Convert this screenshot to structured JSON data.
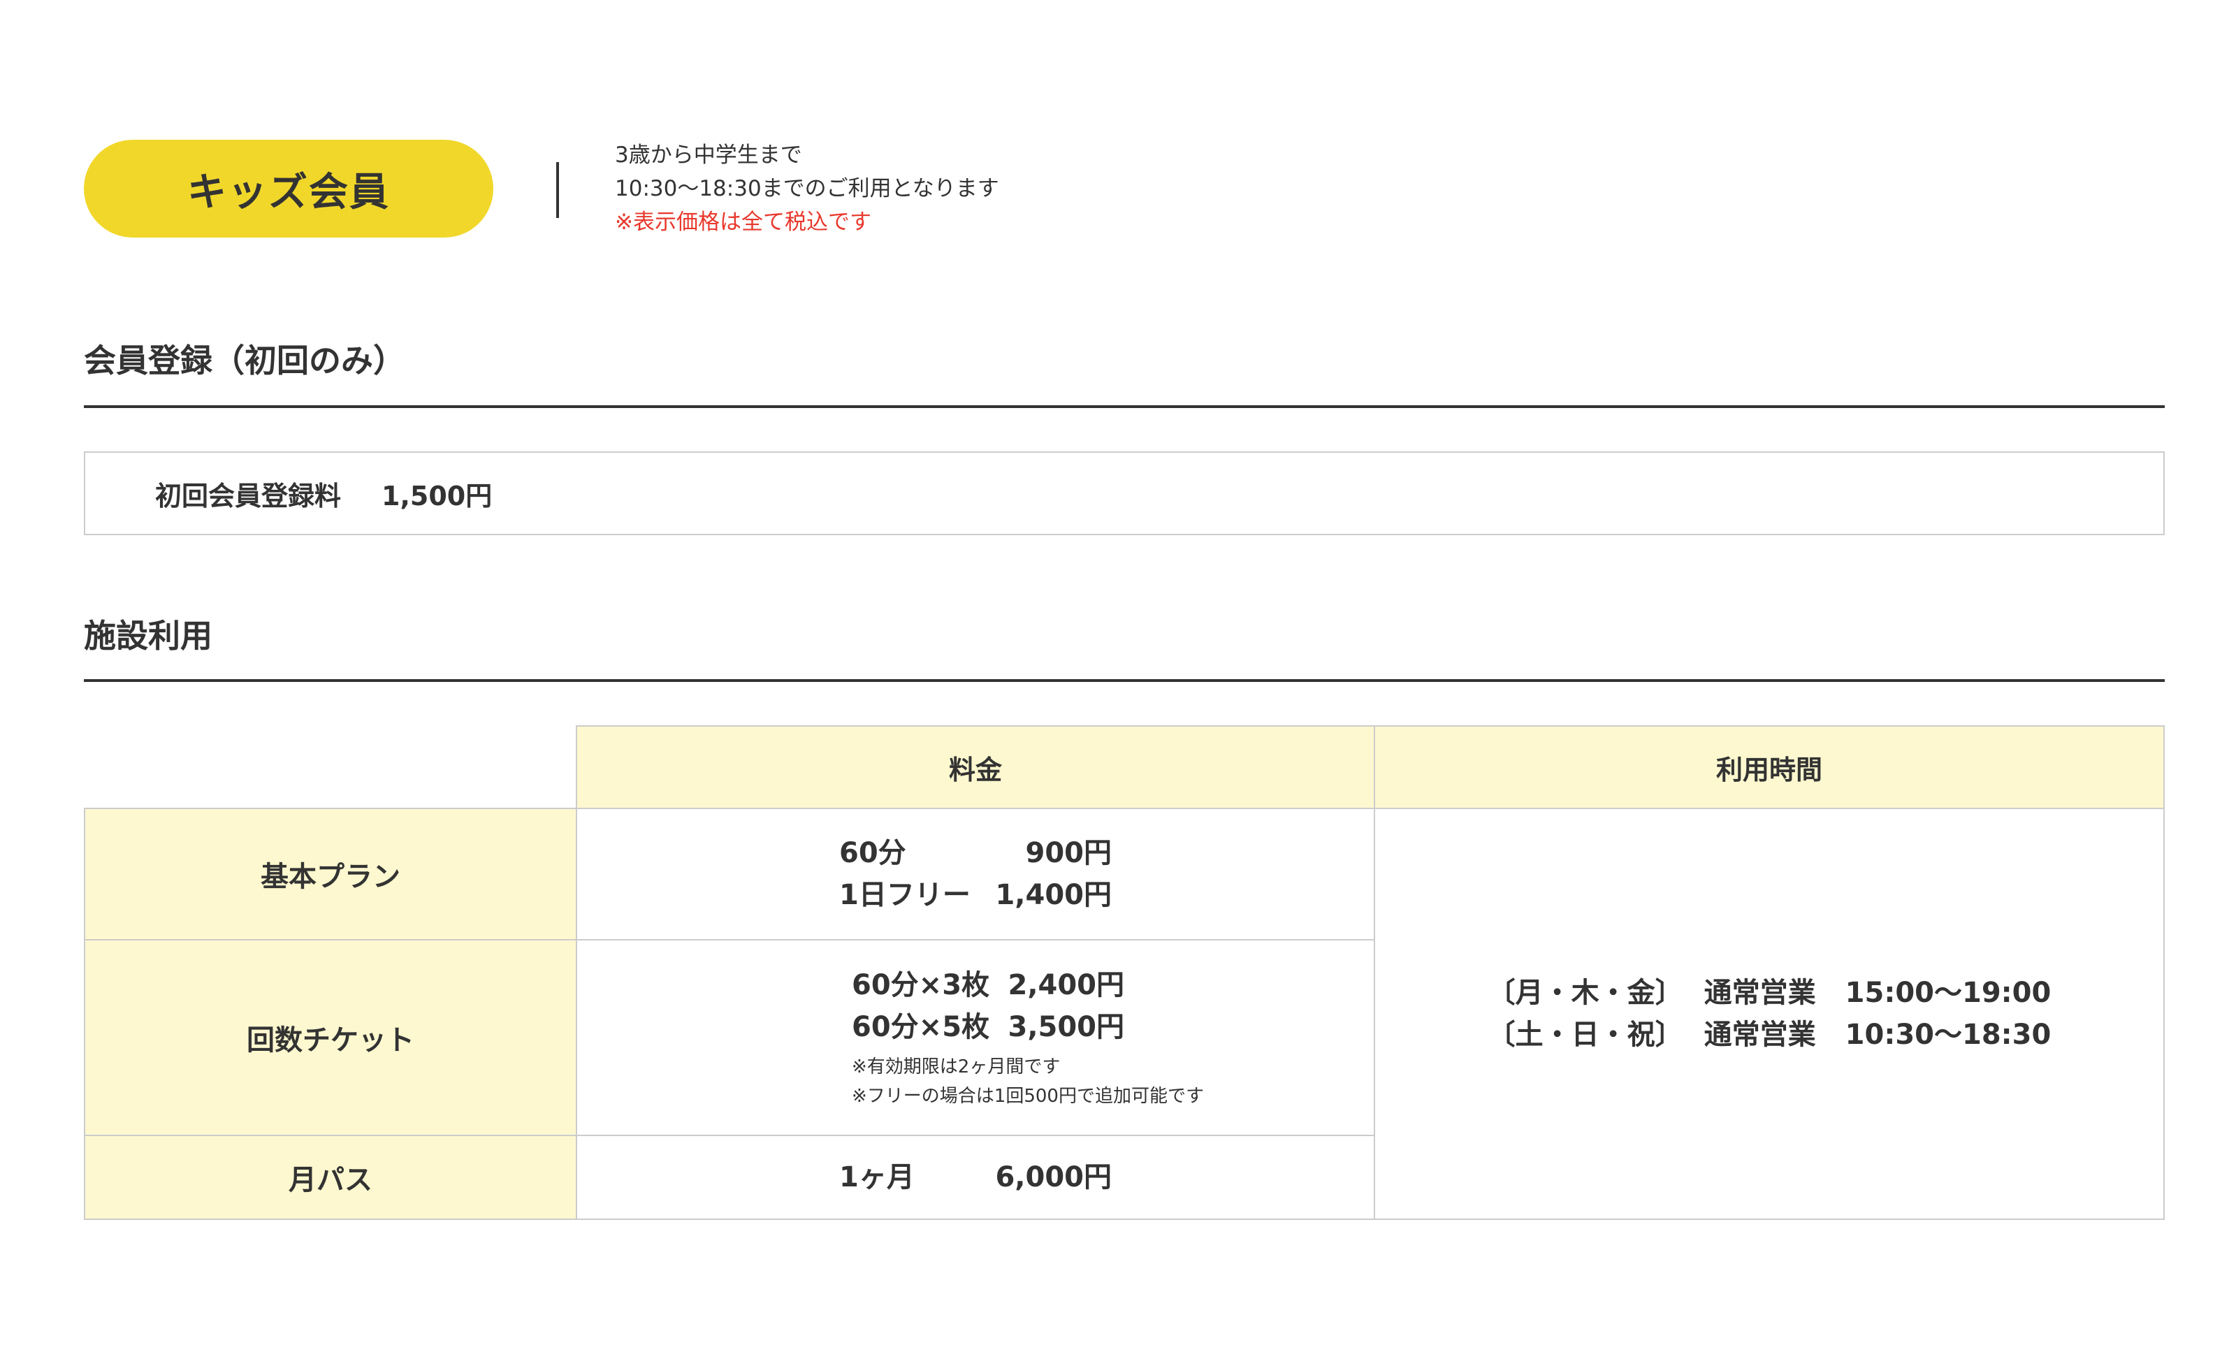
{
  "header": {
    "badge": "キッズ会員",
    "note1": "3歳から中学生まで",
    "note2": "10:30〜18:30までのご利用となります",
    "note3": "※表示価格は全て税込です"
  },
  "registration": {
    "title": "会員登録（初回のみ）",
    "label": "初回会員登録料",
    "price": "1,500円"
  },
  "facility": {
    "title": "施設利用",
    "col_fee": "料金",
    "col_hours": "利用時間",
    "basic": {
      "label": "基本プラン",
      "r1_name": "60分",
      "r1_price": "900円",
      "r2_name": "1日フリー",
      "r2_price": "1,400円"
    },
    "ticket": {
      "label": "回数チケット",
      "r1_name": "60分×3枚",
      "r1_price": "2,400円",
      "r2_name": "60分×5枚",
      "r2_price": "3,500円",
      "note1": "※有効期限は2ヶ月間です",
      "note2": "※フリーの場合は1回500円で追加可能です"
    },
    "monthly": {
      "label": "月パス",
      "r1_name": "1ヶ月",
      "r1_price": "6,000円"
    },
    "hours": [
      {
        "days": "〔月・木・金〕",
        "kind": "通常営業",
        "time": "15:00〜19:00"
      },
      {
        "days": "〔土・日・祝〕",
        "kind": "通常営業",
        "time": "10:30〜18:30"
      }
    ]
  }
}
